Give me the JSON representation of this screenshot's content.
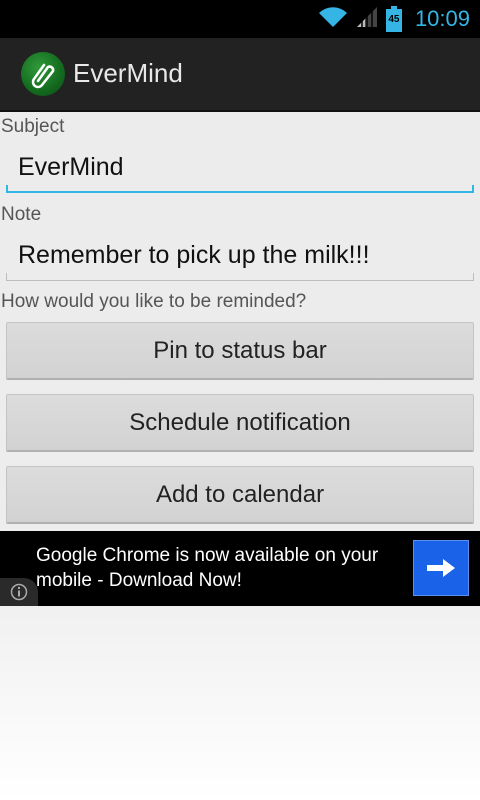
{
  "status_bar": {
    "time": "10:09",
    "battery_level": "45",
    "icons": [
      "wifi-icon",
      "signal-icon",
      "battery-icon"
    ],
    "accent": "#35b5e5"
  },
  "action_bar": {
    "app_title": "EverMind",
    "app_icon": "paperclip-icon"
  },
  "form": {
    "subject_label": "Subject",
    "subject_value": "EverMind",
    "note_label": "Note",
    "note_value": "Remember to pick up the milk!!!",
    "prompt": "How would you like to be reminded?"
  },
  "buttons": {
    "pin": "Pin to status bar",
    "schedule": "Schedule notification",
    "calendar": "Add to calendar"
  },
  "ad": {
    "text": "Google Chrome is now available on your mobile - Download Now!",
    "go_icon": "arrow-right-icon",
    "info_icon": "info-icon",
    "go_color": "#1a63e8"
  }
}
